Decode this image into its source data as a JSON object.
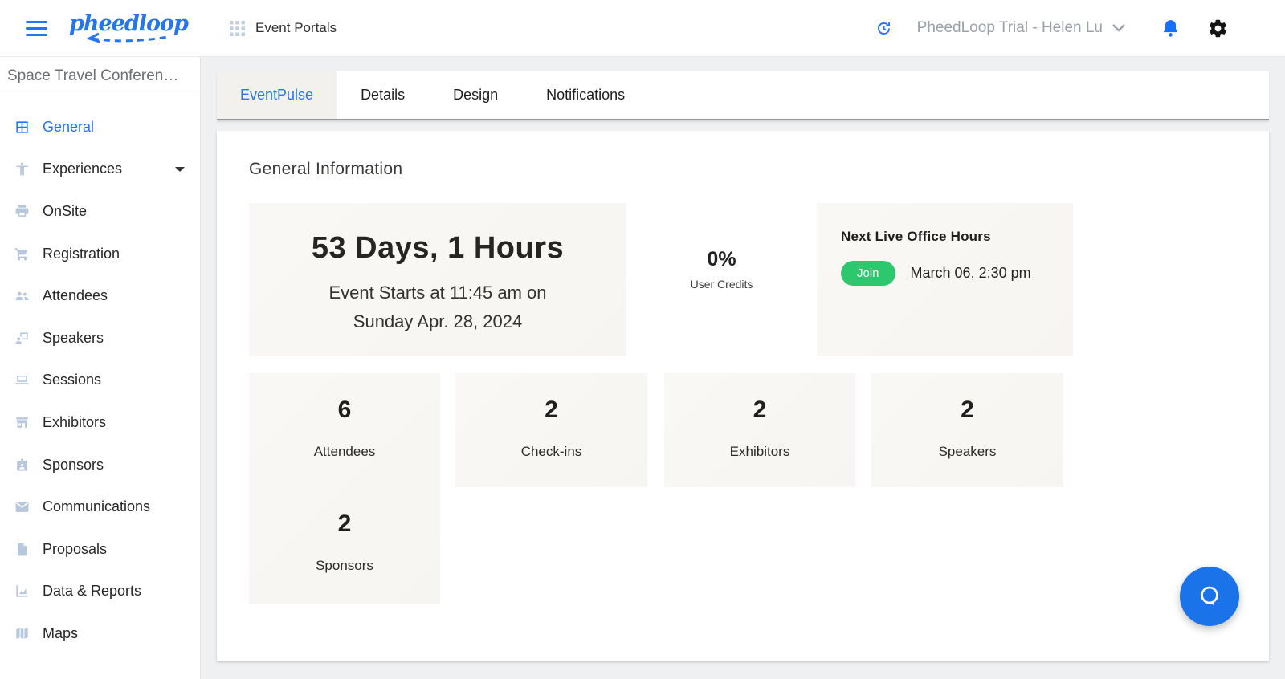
{
  "header": {
    "logo_text": "pheedloop",
    "portal_label": "Event Portals",
    "account_label": "PheedLoop Trial - Helen Lu"
  },
  "sidebar": {
    "event_name": "Space Travel Conferen…",
    "items": [
      {
        "label": "General",
        "active": true
      },
      {
        "label": "Experiences",
        "active": false
      },
      {
        "label": "OnSite",
        "active": false
      },
      {
        "label": "Registration",
        "active": false
      },
      {
        "label": "Attendees",
        "active": false
      },
      {
        "label": "Speakers",
        "active": false
      },
      {
        "label": "Sessions",
        "active": false
      },
      {
        "label": "Exhibitors",
        "active": false
      },
      {
        "label": "Sponsors",
        "active": false
      },
      {
        "label": "Communications",
        "active": false
      },
      {
        "label": "Proposals",
        "active": false
      },
      {
        "label": "Data & Reports",
        "active": false
      },
      {
        "label": "Maps",
        "active": false
      }
    ]
  },
  "tabs": {
    "items": [
      {
        "label": "EventPulse",
        "active": true
      },
      {
        "label": "Details",
        "active": false
      },
      {
        "label": "Design",
        "active": false
      },
      {
        "label": "Notifications",
        "active": false
      }
    ]
  },
  "main": {
    "section_title": "General Information",
    "countdown": {
      "headline": "53 Days, 1 Hours",
      "subline1": "Event Starts at 11:45 am on",
      "subline2": "Sunday Apr. 28, 2024"
    },
    "credits": {
      "value": "0%",
      "label": "User Credits"
    },
    "office_hours": {
      "title": "Next Live Office Hours",
      "join_label": "Join",
      "time": "March 06, 2:30 pm"
    },
    "stats": {
      "col1": [
        {
          "value": "6",
          "label": "Attendees"
        },
        {
          "value": "2",
          "label": "Sponsors"
        }
      ],
      "others": [
        {
          "value": "2",
          "label": "Check-ins"
        },
        {
          "value": "2",
          "label": "Exhibitors"
        },
        {
          "value": "2",
          "label": "Speakers"
        }
      ]
    }
  },
  "icons": {
    "hamburger-icon": "three horizontal bars",
    "grid-icon": "3x3 dots grid",
    "refresh-icon": "circular arrow clock",
    "chevron-down-icon": "v",
    "bell-icon": "filled bell",
    "gear-icon": "filled gear",
    "chat-icon": "speech bubble outline"
  },
  "colors": {
    "accent_blue": "#2575f2",
    "bell_blue": "#1470ff",
    "join_green": "#2dc76e",
    "card_beige": "#f8f6f3",
    "page_gray": "#eef0f1",
    "sidebar_icon": "#b7c7dc"
  }
}
